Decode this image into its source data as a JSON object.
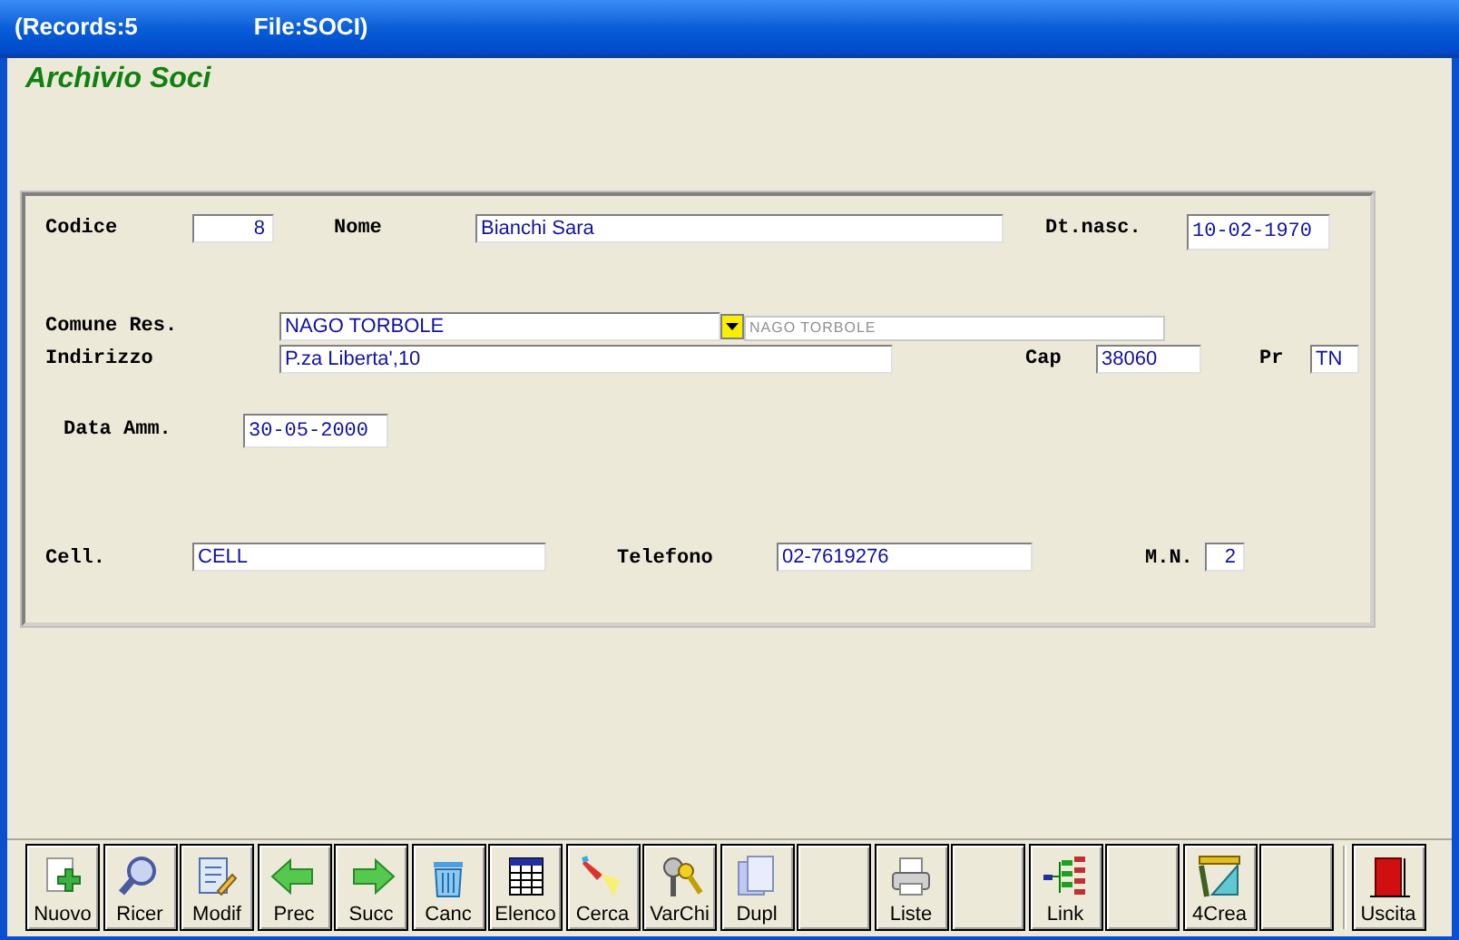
{
  "window": {
    "title_records": "(Records:5",
    "title_file": "File:SOCI)"
  },
  "heading": "Archivio Soci",
  "fields": [
    {
      "label": "Codice",
      "value": "8",
      "kind": "number"
    },
    {
      "label": "Nome",
      "value": "Bianchi Sara",
      "kind": "text"
    },
    {
      "label": "Dt.nasc.",
      "value": "10-02-1970",
      "kind": "date"
    },
    {
      "label": "Comune Res.",
      "value": "NAGO TORBOLE",
      "kind": "combo",
      "lookup": "NAGO TORBOLE"
    },
    {
      "label": "Indirizzo",
      "value": "P.za Liberta',10",
      "kind": "text"
    },
    {
      "label": "Cap",
      "value": "38060",
      "kind": "text"
    },
    {
      "label": "Pr",
      "value": "TN",
      "kind": "text"
    },
    {
      "label": "Data Amm.",
      "value": "30-05-2000",
      "kind": "date"
    },
    {
      "label": "Cell.",
      "value": "CELL",
      "kind": "text"
    },
    {
      "label": "Telefono",
      "value": "02-7619276",
      "kind": "text"
    },
    {
      "label": "M.N.",
      "value": "2",
      "kind": "number"
    }
  ],
  "toolbar": [
    {
      "label": "Nuovo",
      "kind": "new"
    },
    {
      "label": "Ricer",
      "kind": "magnifier"
    },
    {
      "label": "Modif",
      "kind": "edit"
    },
    {
      "label": "Prec",
      "kind": "left"
    },
    {
      "label": "Succ",
      "kind": "right"
    },
    {
      "label": "Canc",
      "kind": "trash"
    },
    {
      "label": "Elenco",
      "kind": "table"
    },
    {
      "label": "Cerca",
      "kind": "torch"
    },
    {
      "label": "VarChi",
      "kind": "keys"
    },
    {
      "label": "Dupl",
      "kind": "copy"
    },
    {
      "kind": "blank"
    },
    {
      "label": "Liste",
      "kind": "printer"
    },
    {
      "kind": "blank"
    },
    {
      "label": "Link",
      "kind": "tree"
    },
    {
      "kind": "blank"
    },
    {
      "label": "4Crea",
      "kind": "ruler"
    },
    {
      "kind": "blank"
    },
    {
      "label": "Uscita",
      "kind": "door"
    }
  ]
}
